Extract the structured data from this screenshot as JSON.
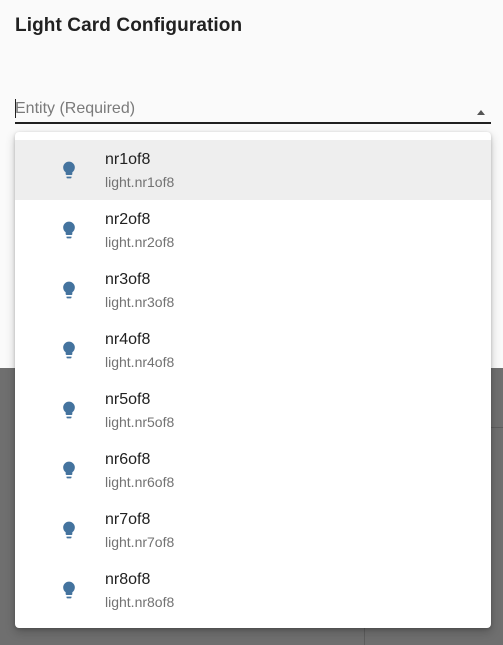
{
  "dialog": {
    "title": "Light Card Configuration"
  },
  "entity_field": {
    "placeholder": "Entity (Required)",
    "value": ""
  },
  "icon": "lightbulb-icon",
  "icon_color": "#44739e",
  "entities": [
    {
      "name": "nr1of8",
      "entity_id": "light.nr1of8",
      "selected": true
    },
    {
      "name": "nr2of8",
      "entity_id": "light.nr2of8",
      "selected": false
    },
    {
      "name": "nr3of8",
      "entity_id": "light.nr3of8",
      "selected": false
    },
    {
      "name": "nr4of8",
      "entity_id": "light.nr4of8",
      "selected": false
    },
    {
      "name": "nr5of8",
      "entity_id": "light.nr5of8",
      "selected": false
    },
    {
      "name": "nr6of8",
      "entity_id": "light.nr6of8",
      "selected": false
    },
    {
      "name": "nr7of8",
      "entity_id": "light.nr7of8",
      "selected": false
    },
    {
      "name": "nr8of8",
      "entity_id": "light.nr8of8",
      "selected": false
    }
  ]
}
